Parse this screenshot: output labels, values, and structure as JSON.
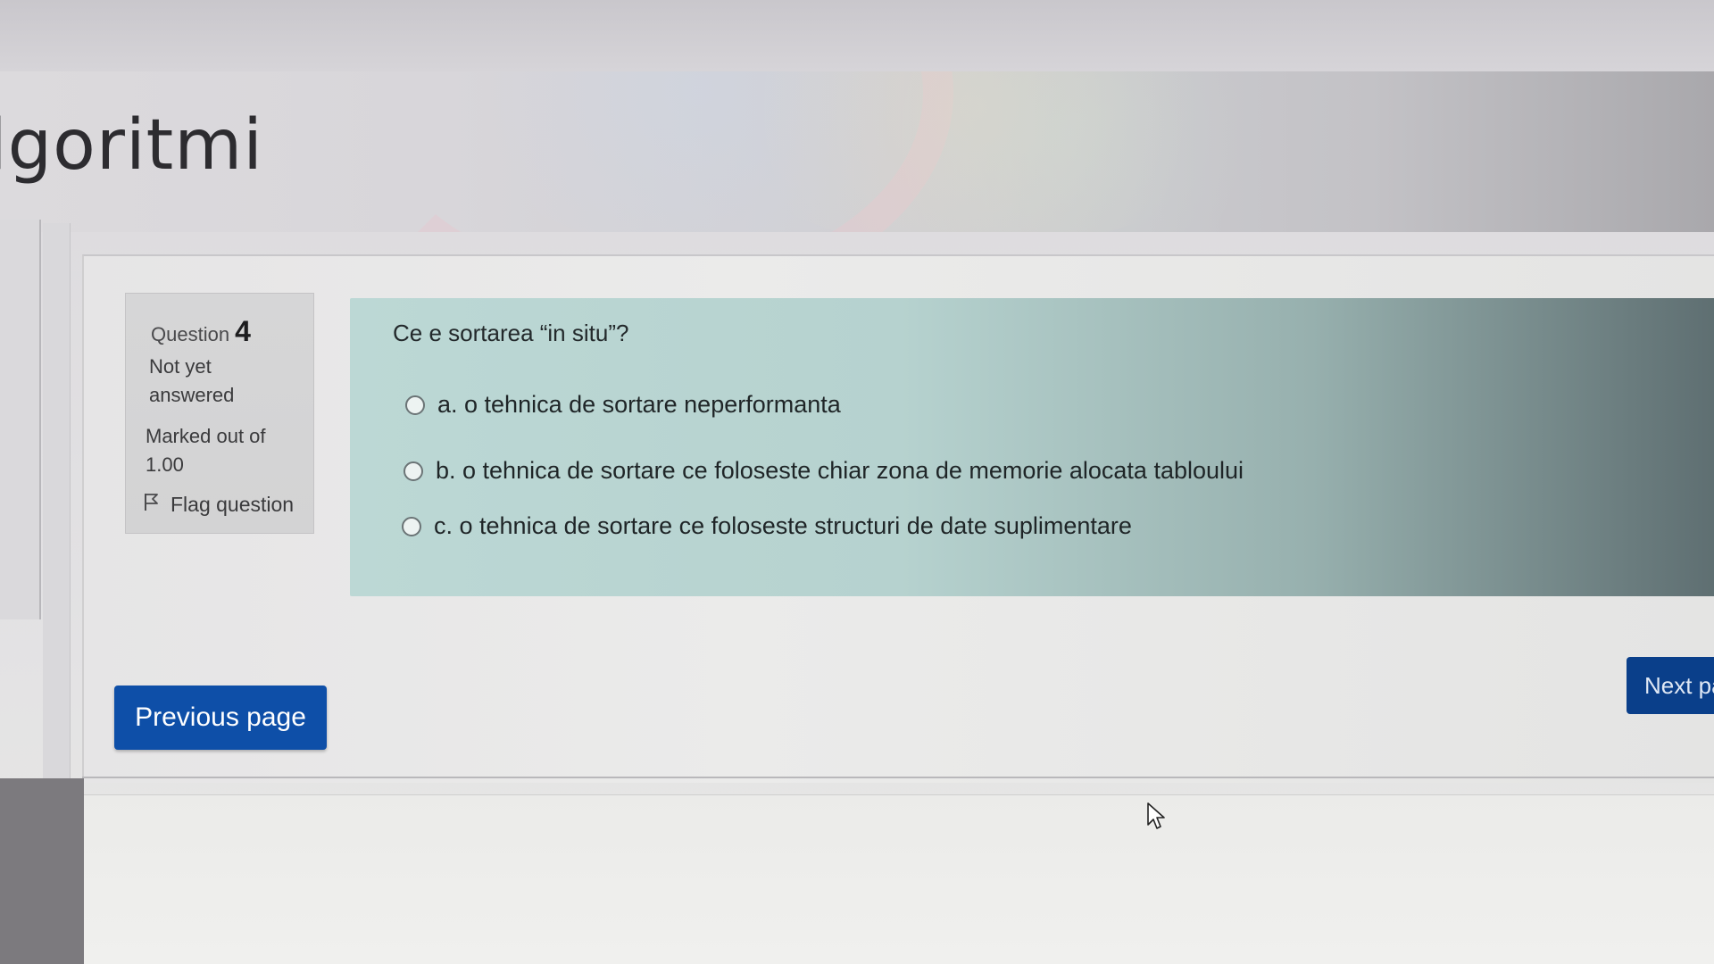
{
  "header": {
    "course_title": "lgoritmi"
  },
  "question_info": {
    "label": "Question",
    "number": "4",
    "state": "Not yet answered",
    "grade": "Marked out of 1.00",
    "flag_label": "Flag question"
  },
  "question": {
    "text": "Ce e sortarea “in situ”?",
    "options": [
      {
        "label": "a. o tehnica de sortare neperformanta",
        "selected": false
      },
      {
        "label": "b. o tehnica de sortare ce foloseste chiar zona de memorie alocata tabloului",
        "selected": false
      },
      {
        "label": "c. o tehnica de sortare ce foloseste structuri de date suplimentare",
        "selected": false
      }
    ]
  },
  "navigation": {
    "previous_label": "Previous page",
    "next_label": "Next pa"
  },
  "colors": {
    "primary_button": "#0e4fa8",
    "question_bg": "#bcd8d5",
    "info_bg": "#d6d6d7"
  }
}
